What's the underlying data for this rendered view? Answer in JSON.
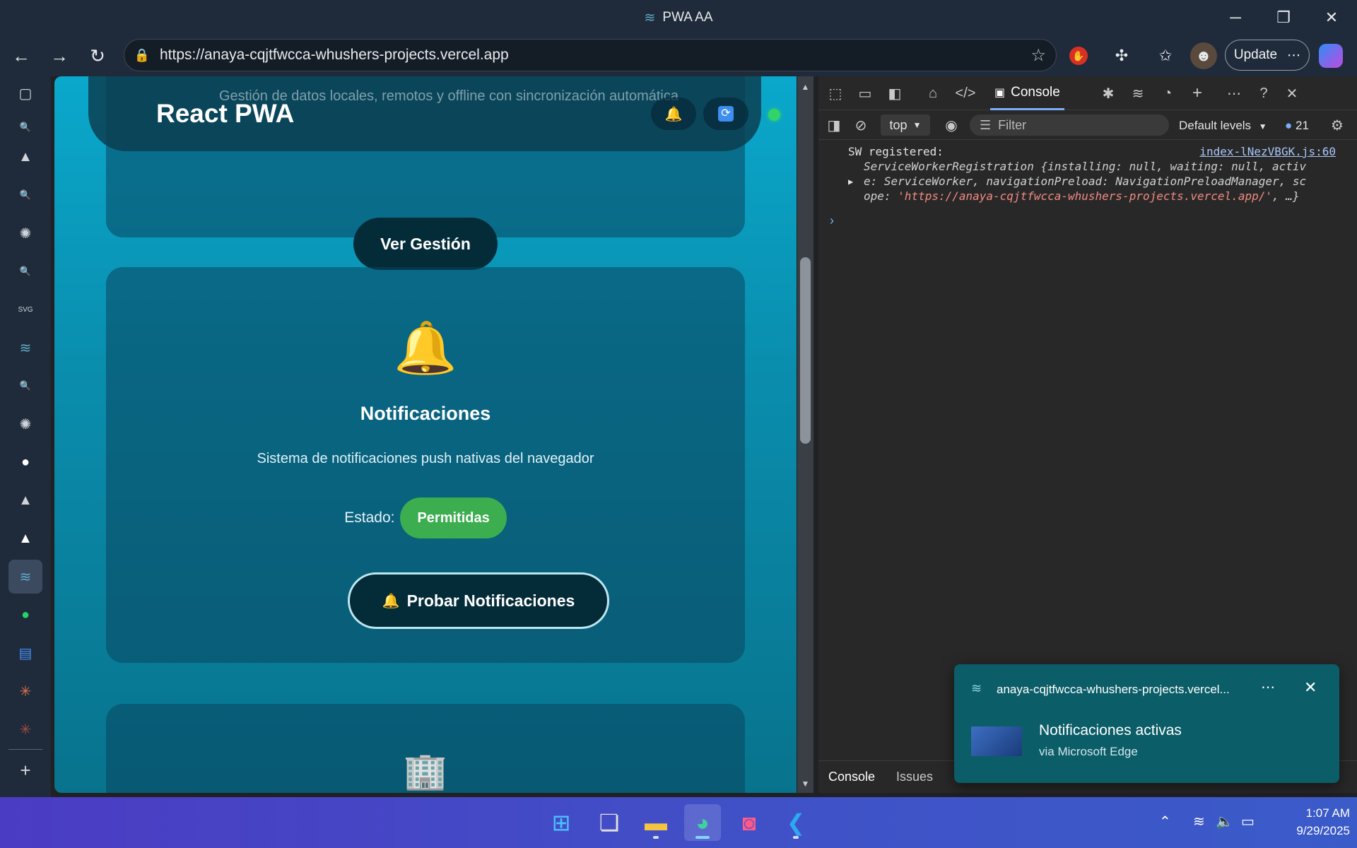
{
  "window": {
    "title": "PWA AA"
  },
  "browser": {
    "url": "https://anaya-cqjtfwcca-whushers-projects.vercel.app",
    "update_label": "Update"
  },
  "page": {
    "header": {
      "title": "React PWA",
      "subtitle": "Gestión de datos locales, remotos y offline con sincronización automática",
      "status_color": "#32d36b"
    },
    "management_button": "Ver Gestión",
    "notifications_card": {
      "title": "Notificaciones",
      "description": "Sistema de notificaciones push nativas del navegador",
      "status_label": "Estado:",
      "status_value": "Permitidas",
      "status_color": "#3cae4f",
      "test_button": "Probar Notificaciones"
    }
  },
  "devtools": {
    "active_tab": "Console",
    "context": "top",
    "filter_placeholder": "Filter",
    "levels": "Default levels",
    "message_count": "21",
    "log": {
      "message": "SW registered:",
      "source": "index-lNezVBGK.js:60",
      "line1": "ServiceWorkerRegistration {installing: null, waiting: null, activ",
      "line2": "e: ServiceWorker, navigationPreload: NavigationPreloadManager, sc",
      "line3_prefix": "ope: ",
      "line3_string": "'https://anaya-cqjtfwcca-whushers-projects.vercel.app/'",
      "line3_suffix": ", …}"
    },
    "bottom_tabs": [
      "Console",
      "Issues"
    ]
  },
  "toast": {
    "origin": "anaya-cqjtfwcca-whushers-projects.vercel...",
    "title": "Notificaciones activas",
    "subtitle": "via Microsoft Edge"
  },
  "taskbar": {
    "time": "1:07 AM",
    "date": "9/29/2025"
  }
}
